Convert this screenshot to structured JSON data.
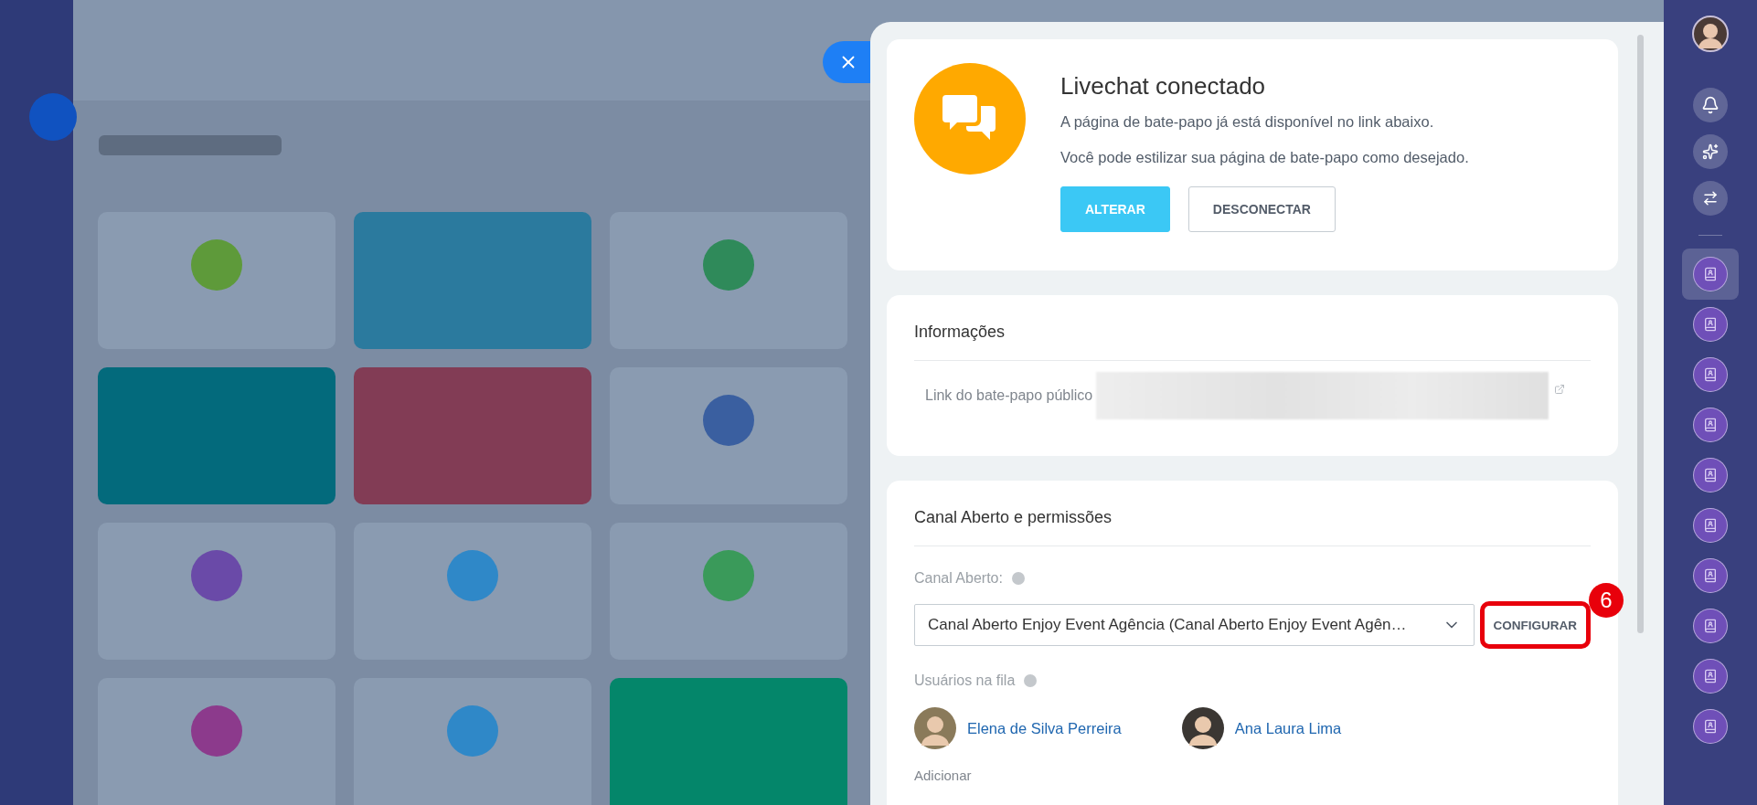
{
  "status_card": {
    "title": "Livechat conectado",
    "lines": [
      "A página de bate-papo já está disponível no link abaixo.",
      "Você pode estilizar sua página de bate-papo como desejado."
    ],
    "buttons": [
      {
        "label": "ALTERAR",
        "kind": "primary"
      },
      {
        "label": "DESCONECTAR",
        "kind": "secondary"
      }
    ]
  },
  "info_card": {
    "title": "Informações",
    "rows": [
      {
        "label": "Link do bate-papo público"
      }
    ]
  },
  "channel_card": {
    "title": "Canal Aberto e permissões",
    "channel_field": {
      "label": "Canal Aberto:",
      "value": "Canal Aberto Enjoy Event Agência (Canal Aberto Enjoy Event Agên…",
      "button": "CONFIGURAR",
      "badge": "6"
    },
    "queue": {
      "label": "Usuários na fila",
      "users": [
        {
          "name": "Elena de Silva Perreira"
        },
        {
          "name": "Ana Laura Lima"
        }
      ]
    },
    "add_label": "Adicionar"
  },
  "right_bar": {
    "items": [
      {
        "kind": "avatar"
      },
      {
        "kind": "bell"
      },
      {
        "kind": "sparkle"
      },
      {
        "kind": "swap"
      },
      {
        "kind": "divider"
      },
      {
        "kind": "contact",
        "selected": true
      },
      {
        "kind": "contact",
        "selected": false
      },
      {
        "kind": "contact",
        "selected": false
      },
      {
        "kind": "contact",
        "selected": false
      },
      {
        "kind": "contact",
        "selected": false
      },
      {
        "kind": "contact",
        "selected": false
      },
      {
        "kind": "contact",
        "selected": false
      },
      {
        "kind": "contact",
        "selected": false
      },
      {
        "kind": "contact",
        "selected": false
      },
      {
        "kind": "contact",
        "selected": false
      }
    ]
  }
}
